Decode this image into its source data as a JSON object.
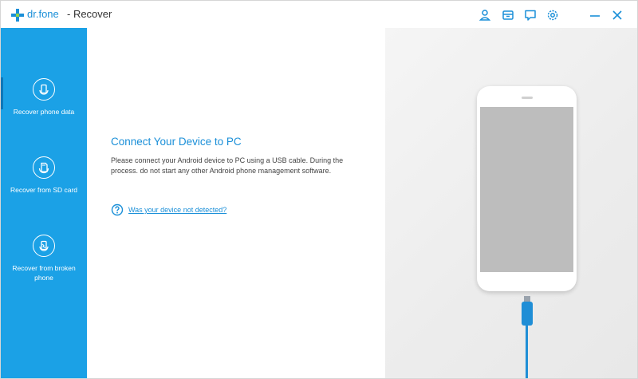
{
  "app": {
    "brand": "dr.fone",
    "title_suffix": "- Recover",
    "accent_color": "#1ba1e6"
  },
  "titlebar": {
    "icons": [
      "account-icon",
      "cart-icon",
      "feedback-icon",
      "settings-icon",
      "minimize-icon",
      "close-icon"
    ]
  },
  "sidebar": {
    "items": [
      {
        "label": "Recover phone data",
        "icon": "phone-recover-icon",
        "active": true
      },
      {
        "label": "Recover from SD card",
        "icon": "sd-card-icon",
        "active": false
      },
      {
        "label": "Recover from broken phone",
        "icon": "broken-phone-icon",
        "active": false
      }
    ]
  },
  "main": {
    "heading": "Connect Your Device to PC",
    "description": "Please connect your Android device to PC using a USB cable. During the process. do not start any other Android phone management software.",
    "help_link": "Was your device not detected?"
  }
}
